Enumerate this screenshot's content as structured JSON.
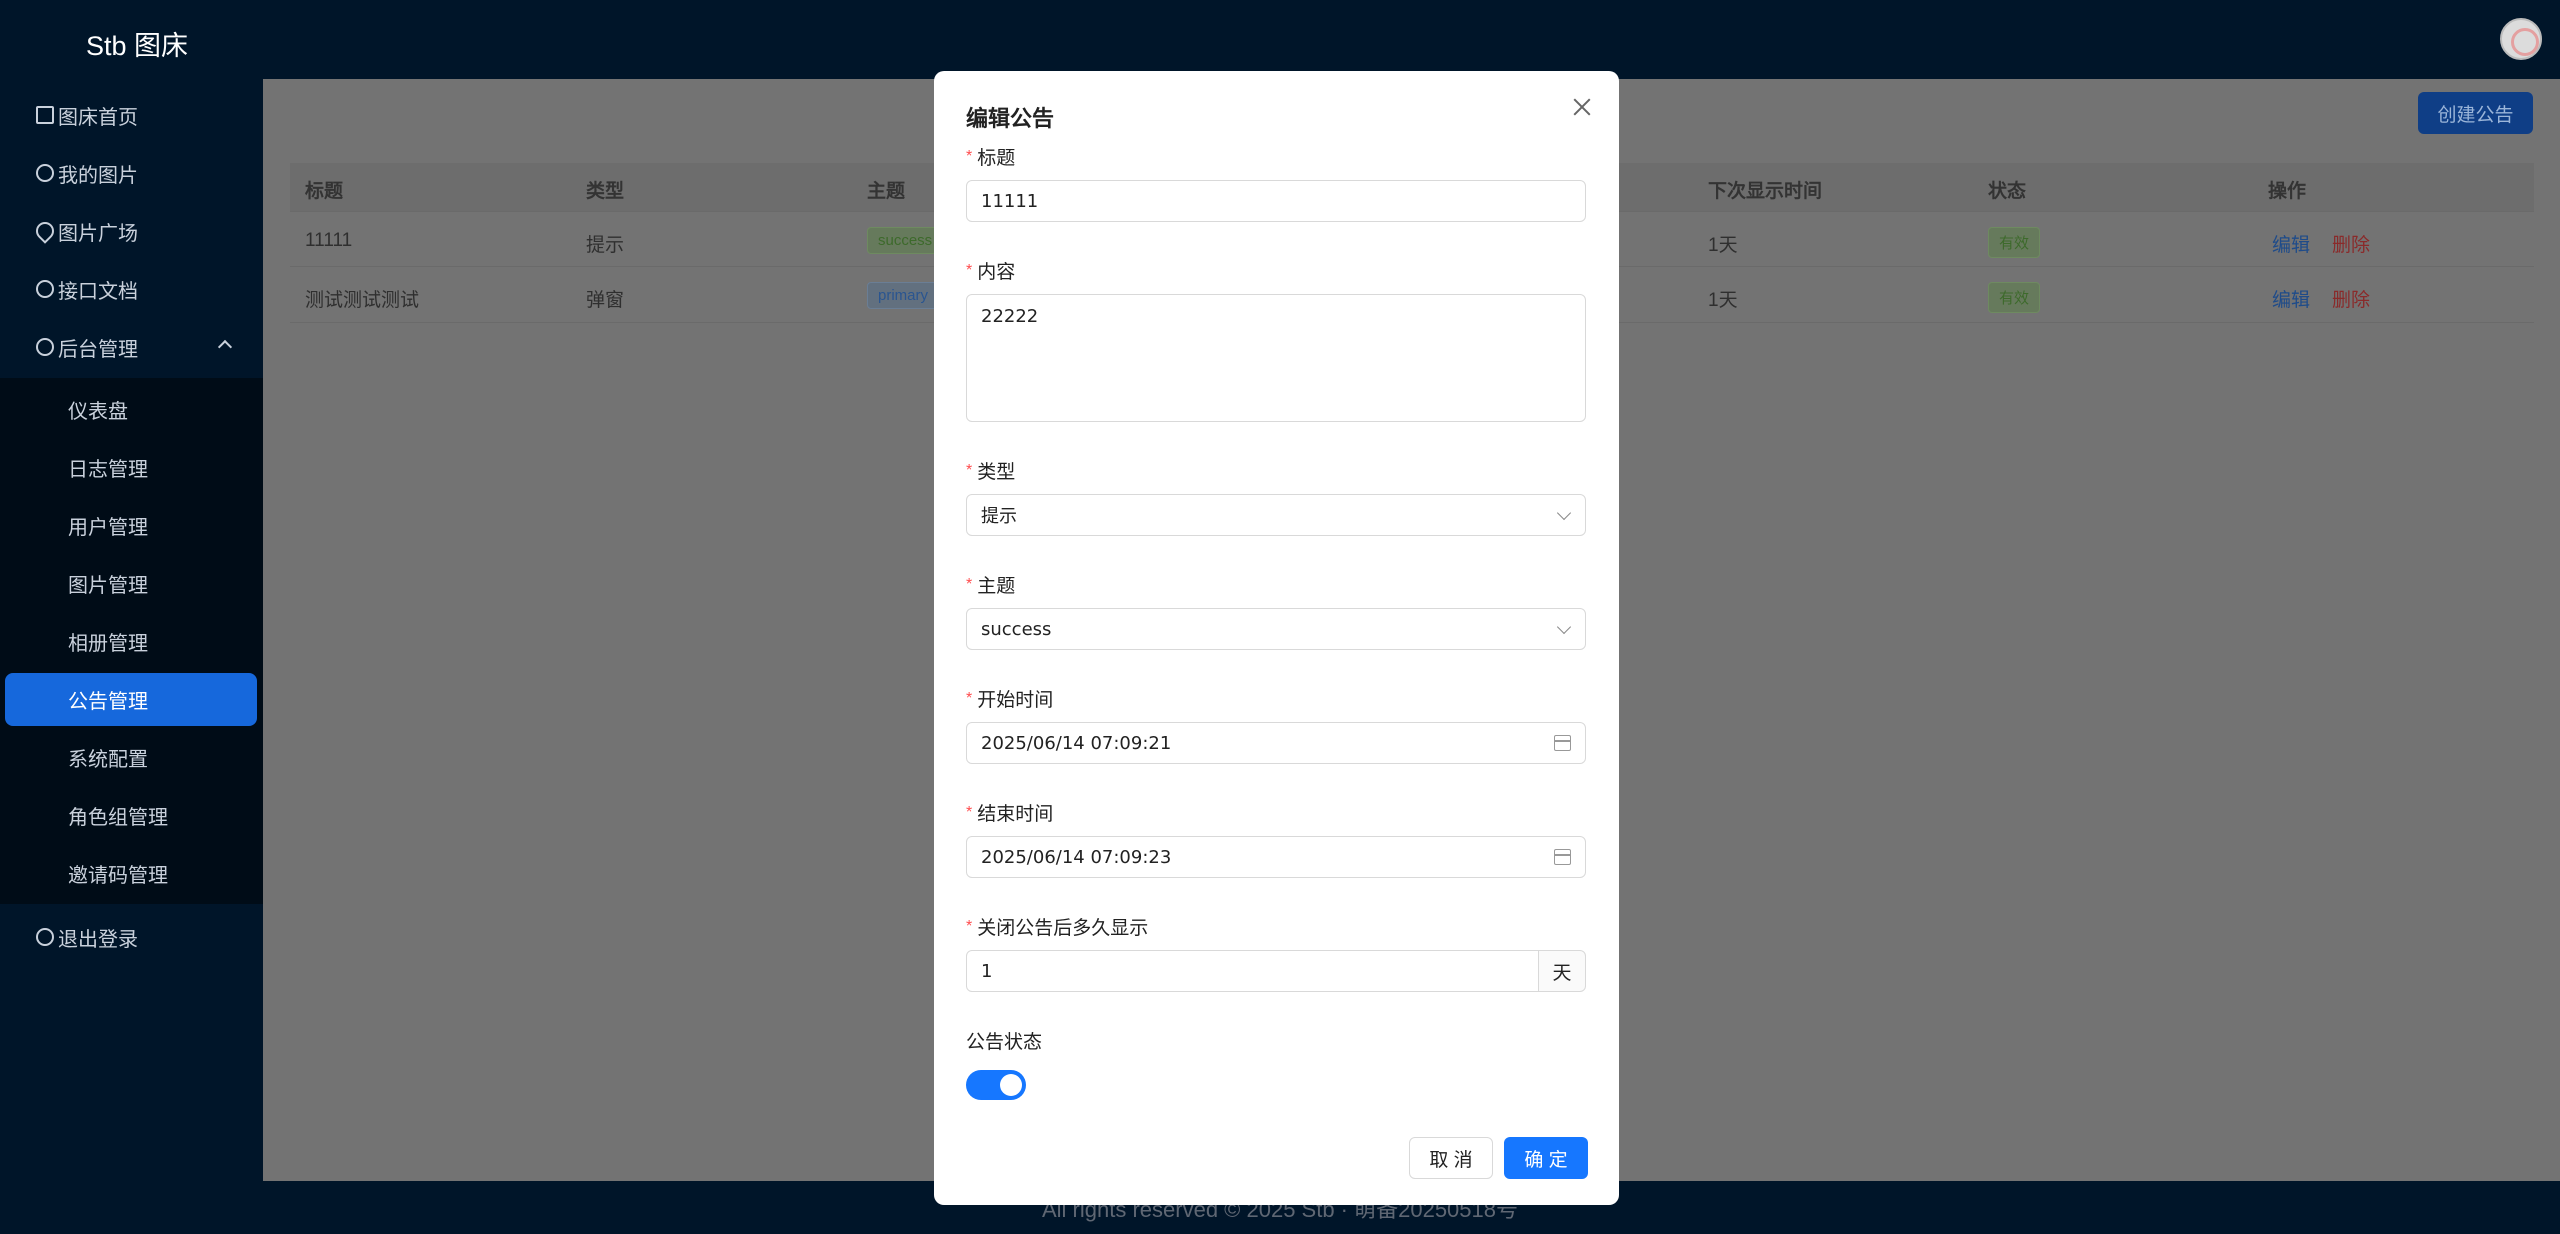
{
  "header": {
    "brand": "Stb 图床"
  },
  "sidebar": {
    "items": [
      {
        "label": "图床首页",
        "icon": "home-icon"
      },
      {
        "label": "我的图片",
        "icon": "image-icon"
      },
      {
        "label": "图片广场",
        "icon": "fire-icon"
      },
      {
        "label": "接口文档",
        "icon": "question-icon"
      },
      {
        "label": "后台管理",
        "icon": "gear-icon"
      }
    ],
    "admin_sub": [
      "仪表盘",
      "日志管理",
      "用户管理",
      "图片管理",
      "相册管理",
      "公告管理",
      "系统配置",
      "角色组管理",
      "邀请码管理"
    ],
    "active_sub": "公告管理",
    "logout": "退出登录"
  },
  "toolbar": {
    "create_label": "创建公告"
  },
  "table": {
    "headers": [
      "标题",
      "类型",
      "主题",
      "下次显示时间",
      "状态",
      "操作"
    ],
    "rows": [
      {
        "title": "11111",
        "type": "提示",
        "theme": "success",
        "next": "1天",
        "status": "有效",
        "edit": "编辑",
        "del": "删除"
      },
      {
        "title": "测试测试测试",
        "type": "弹窗",
        "theme": "primary",
        "next": "1天",
        "status": "有效",
        "edit": "编辑",
        "del": "删除"
      }
    ]
  },
  "footer": {
    "text": "All rights reserved © 2025 Stb · 萌备20250518号"
  },
  "modal": {
    "title": "编辑公告",
    "fields": {
      "title": {
        "label": "标题",
        "value": "11111"
      },
      "content": {
        "label": "内容",
        "value": "22222"
      },
      "type": {
        "label": "类型",
        "value": "提示"
      },
      "theme": {
        "label": "主题",
        "value": "success"
      },
      "start": {
        "label": "开始时间",
        "value": "2025/06/14 07:09:21"
      },
      "end": {
        "label": "结束时间",
        "value": "2025/06/14 07:09:23"
      },
      "reshow": {
        "label": "关闭公告后多久显示",
        "value": "1",
        "unit": "天"
      },
      "status": {
        "label": "公告状态",
        "on": true
      }
    },
    "cancel_label": "取 消",
    "ok_label": "确 定"
  },
  "colors": {
    "primary": "#1677ff",
    "sidebar_bg": "#001529",
    "active_bg": "#1668dc"
  }
}
